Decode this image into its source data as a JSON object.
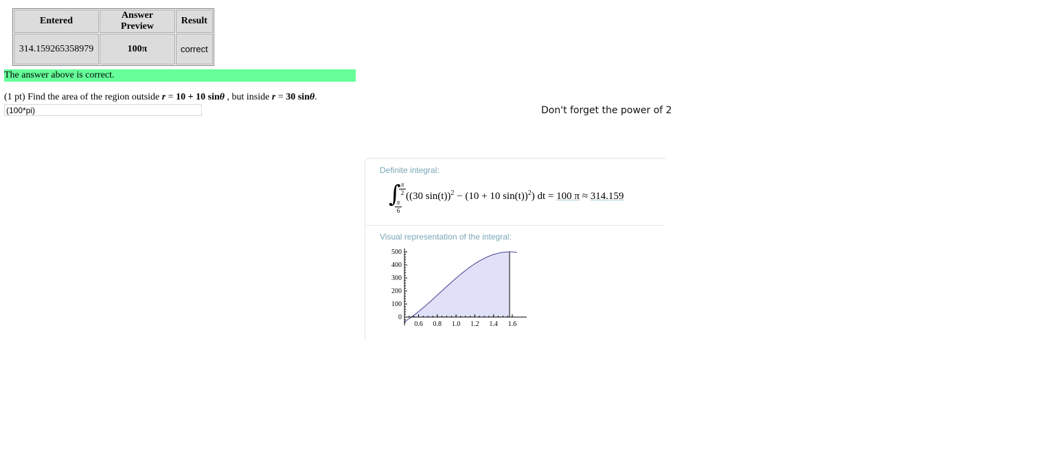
{
  "results_table": {
    "headers": [
      "Entered",
      "Answer Preview",
      "Result"
    ],
    "rows": [
      {
        "entered": "314.159265358979",
        "preview": "100π",
        "result": "correct"
      }
    ]
  },
  "status_banner": "The answer above is correct.",
  "problem": {
    "prefix": "(1 pt) Find the area of the region outside ",
    "r1": "r",
    "eq1": " = ",
    "expr1": "10 + 10 sin",
    "theta1": "θ",
    "middle": " , but inside ",
    "r2": "r",
    "eq2": " = ",
    "expr2": "30 sin",
    "theta2": "θ",
    "suffix": "."
  },
  "answer_input": {
    "value": "(100*pi)"
  },
  "hint": "Don't forget the power of 2",
  "panel": {
    "pod1_title": "Definite integral:",
    "upper_limit_num": "π",
    "upper_limit_den": "2",
    "lower_limit_num": "π",
    "lower_limit_den": "6",
    "integrand": "((30 sin(t))",
    "integrand_mid": " − (10 + 10 sin(t))",
    "integrand_end": ") dt = ",
    "exact_value": "100 π",
    "approx_symbol": " ≈ ",
    "approx_value": "314.159",
    "exp2": "2",
    "pod2_title": "Visual representation of the integral:"
  },
  "chart_data": {
    "type": "area",
    "function": "(30 sin(t))^2 - (10 + 10 sin(t))^2",
    "shaded_interval": [
      0.5236,
      1.5708
    ],
    "xlim": [
      0.45,
      1.65
    ],
    "ylim": [
      -60,
      510
    ],
    "x_ticks": [
      "0.6",
      "0.8",
      "1.0",
      "1.2",
      "1.4",
      "1.6"
    ],
    "y_ticks": [
      "0",
      "100",
      "200",
      "300",
      "400",
      "500"
    ],
    "fill_color": "#e0e0f8",
    "line_color": "#3f3f8f",
    "sample_points": [
      {
        "x": 0.45,
        "y": -69
      },
      {
        "x": 0.5236,
        "y": 0
      },
      {
        "x": 0.6,
        "y": 71
      },
      {
        "x": 0.8,
        "y": 240
      },
      {
        "x": 1.0,
        "y": 362
      },
      {
        "x": 1.2,
        "y": 449
      },
      {
        "x": 1.4,
        "y": 492
      },
      {
        "x": 1.5708,
        "y": 500
      },
      {
        "x": 1.65,
        "y": 492
      }
    ]
  },
  "colors": {
    "banner": "#66ff99",
    "table_cell": "#dcdcdc",
    "pod_title": "#7aa6b8"
  }
}
